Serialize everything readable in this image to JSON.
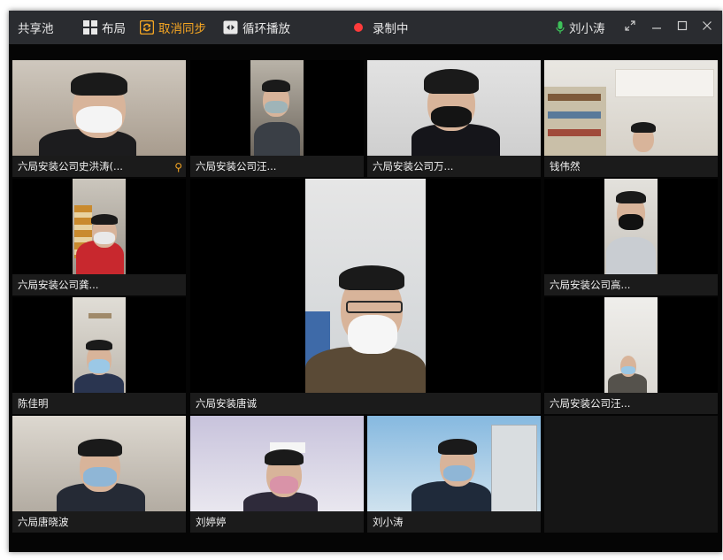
{
  "titlebar": {
    "app_name": "共享池",
    "layout_label": "布局",
    "unsync_label": "取消同步",
    "loop_label": "循环播放",
    "recording_label": "录制中",
    "user_name": "刘小涛"
  },
  "participants": [
    {
      "name": "六局安装公司史洪涛(..."
    },
    {
      "name": "六局安装公司汪..."
    },
    {
      "name": "六局安装公司万..."
    },
    {
      "name": "钱伟然"
    },
    {
      "name": "六局安装公司龚..."
    },
    {
      "name": "六局安装唐诚"
    },
    {
      "name": "六局安装公司高..."
    },
    {
      "name": "陈佳明"
    },
    {
      "name": "六局安装公司汪..."
    },
    {
      "name": "六局唐晓波"
    },
    {
      "name": "刘婷婷"
    },
    {
      "name": "刘小涛"
    }
  ],
  "colors": {
    "accent": "#f5a623",
    "recording": "#ff3b3b",
    "mic": "#3ec25a"
  }
}
